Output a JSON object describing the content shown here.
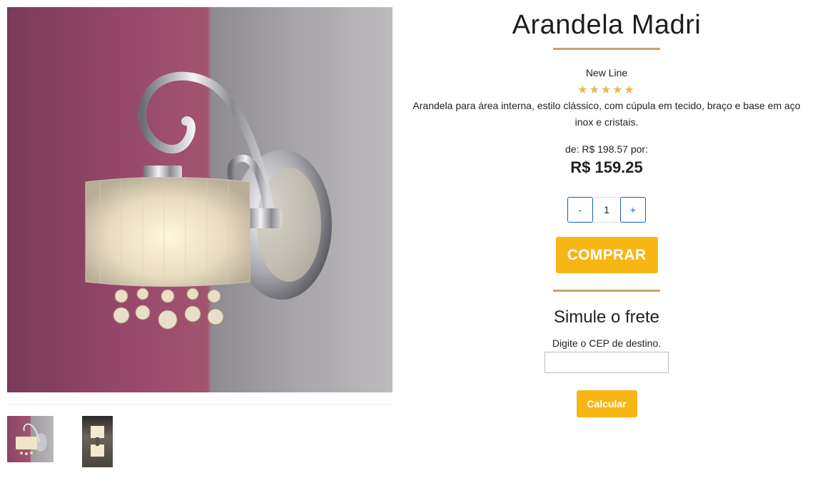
{
  "product": {
    "title": "Arandela Madri",
    "brand": "New Line",
    "rating_stars": 5,
    "stars_display": "★★★★★",
    "description": "Arandela para área interna, estilo clássico, com cúpula em tecido, braço e base em aço inox e cristais.",
    "price_old_text": "de: R$ 198.57 por:",
    "price_new_text": "R$ 159.25"
  },
  "quantity": {
    "minus_label": "-",
    "value": "1",
    "plus_label": "+"
  },
  "buy_button": {
    "label": "COMPRAR"
  },
  "shipping": {
    "title": "Simule o frete",
    "cep_label": "Digite o CEP de destino.",
    "cep_value": "",
    "calculate_label": "Calcular"
  },
  "colors": {
    "accent_gold": "#c9a46a",
    "button_yellow": "#f7b614",
    "qty_blue": "#1a5fb4",
    "star_color": "#e8b84a"
  },
  "gallery": {
    "thumbnails": [
      "thumb-lamp-madri",
      "thumb-lamp-alt"
    ]
  }
}
